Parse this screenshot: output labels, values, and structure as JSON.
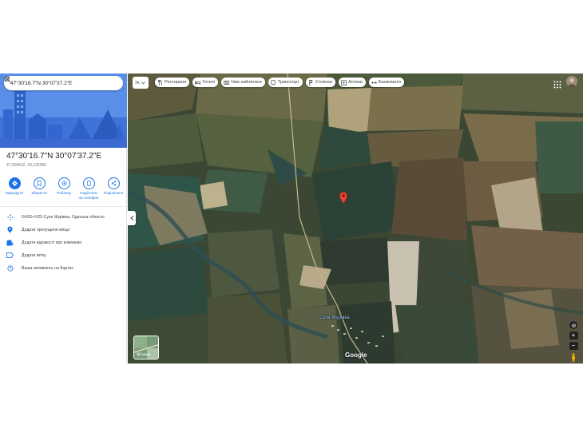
{
  "search": {
    "value": "47°30'16.7\"N 30°07'37.2\"E"
  },
  "place": {
    "title": "47°30'16.7\"N 30°07'37.2\"E",
    "subtitle": "47,504642, 30,126992"
  },
  "actions": [
    {
      "label": "Маршрути",
      "icon": "directions-icon"
    },
    {
      "label": "Зберегти",
      "icon": "bookmark-icon"
    },
    {
      "label": "Поблизу",
      "icon": "nearby-icon"
    },
    {
      "label": "Надіслати на телефон",
      "icon": "phone-icon"
    },
    {
      "label": "Поділитися",
      "icon": "share-icon"
    }
  ],
  "details": [
    {
      "text": "G43G+V25 Суха Журівка, Одеська область",
      "icon": "pluscode-icon"
    },
    {
      "text": "Додати пропущене місце",
      "icon": "add-place-icon"
    },
    {
      "text": "Додати відомості про компанію",
      "icon": "business-icon"
    },
    {
      "text": "Додати мітку",
      "icon": "label-icon"
    },
    {
      "text": "Ваша активність на Картах",
      "icon": "history-icon"
    }
  ],
  "map": {
    "lang": "Ук",
    "chips": [
      {
        "label": "Ресторани",
        "icon": "restaurant-icon"
      },
      {
        "label": "Готелі",
        "icon": "hotel-icon"
      },
      {
        "label": "Чим зайнятися",
        "icon": "camera-icon"
      },
      {
        "label": "Транспорт",
        "icon": "transit-icon"
      },
      {
        "label": "Стоянки",
        "icon": "parking-icon"
      },
      {
        "label": "Аптеки",
        "icon": "pharmacy-icon"
      },
      {
        "label": "Банкомати",
        "icon": "atm-icon"
      }
    ],
    "village_label": "Суха Журівка",
    "layers_label": "Шари",
    "google_logo": "Google",
    "zoom_in": "+",
    "zoom_out": "−"
  },
  "colors": {
    "accent": "#1a73e8",
    "pin": "#ea4335",
    "hero": "#4f86e8"
  }
}
